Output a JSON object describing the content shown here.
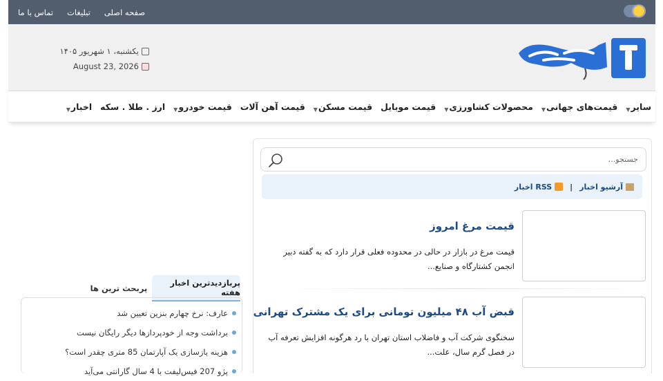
{
  "topbar": {
    "links": [
      "صفحه اصلی",
      "تبلیغات",
      "تماس با ما"
    ]
  },
  "header": {
    "date_persian": "یکشنبه، ۱ شهریور ۱۴۰۵",
    "date_gregorian": "August 23, 2026"
  },
  "nav": {
    "items": [
      {
        "label": "اخبار",
        "has_dropdown": true
      },
      {
        "label": "ارز . طلا . سکه",
        "has_dropdown": false
      },
      {
        "label": "قیمت خودرو",
        "has_dropdown": true
      },
      {
        "label": "قیمت آهن آلات",
        "has_dropdown": false
      },
      {
        "label": "قیمت مسکن",
        "has_dropdown": true
      },
      {
        "label": "قیمت موبایل",
        "has_dropdown": false
      },
      {
        "label": "محصولات کشاورزی",
        "has_dropdown": true
      },
      {
        "label": "قیمت‌های جهانی",
        "has_dropdown": true
      },
      {
        "label": "سایر",
        "has_dropdown": true
      }
    ]
  },
  "search": {
    "placeholder": "جستجو..."
  },
  "feed": {
    "rss_label": "RSS اخبار",
    "separator": "|",
    "archive_label": "آرشیو اخبار"
  },
  "articles": [
    {
      "title": "قیمت مرغ امروز",
      "summary": "قیمت مرغ در بازار در حالی در محدوده فعلی قرار دارد که به گفته دبیر انجمن کشتارگاه و صنایع..."
    },
    {
      "title": "قبض آب ۴۸ میلیون تومانی برای یک مشترک تهرانی",
      "summary": "سخنگوی شرکت آب و فاضلاب استان تهران با رد هرگونه افزایش تعرفه آب در فصل گرم سال، علت..."
    }
  ],
  "sidebar": {
    "tabs": [
      "پربازدیدترین اخبار هفته",
      "پربحث ترین ها"
    ],
    "items": [
      "عارف: نرخ چهارم بنزین تعیین شد",
      "برداشت وجه از خودپردازها دیگر رایگان نیست",
      "هزینه بازسازی یک آپارتمان 85 متری چقدر است؟",
      "پژو 207 فیس‌لیفت با 4 سال گارانتی می‌آید"
    ]
  },
  "colors": {
    "topbar": "#525e6e",
    "header_bg": "#f0f0f0",
    "title_blue": "#1a4b86",
    "feed_bg": "#e9f1f9",
    "logo_blue": "#2a6fd6"
  },
  "icons": {
    "theme_toggle": "sun-icon",
    "search": "search-icon",
    "rss": "rss-icon",
    "archive": "archive-icon",
    "calendar": "calendar-icon"
  }
}
